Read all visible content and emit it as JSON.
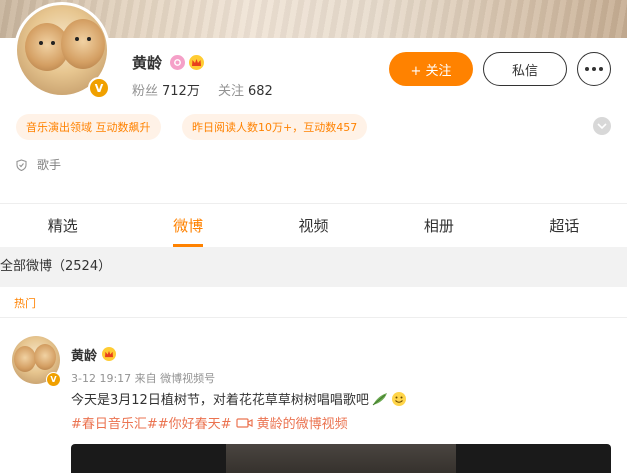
{
  "profile": {
    "name": "黄龄",
    "fans_label": "粉丝",
    "fans_count": "712万",
    "following_label": "关注",
    "following_count": "682",
    "verified_mark": "V",
    "follow_button": "+ 关注",
    "message_button": "私信",
    "tags": [
      "音乐演出领域 互动数飙升",
      "昨日阅读人数10万+，互动数457"
    ],
    "occupation": "歌手"
  },
  "tabs": [
    {
      "label": "精选",
      "active": false
    },
    {
      "label": "微博",
      "active": true
    },
    {
      "label": "视频",
      "active": false
    },
    {
      "label": "相册",
      "active": false
    },
    {
      "label": "超话",
      "active": false
    }
  ],
  "feed": {
    "all_label": "全部微博（2524）",
    "hot_label": "热门",
    "post": {
      "author": "黄龄",
      "time": "3-12 19:17",
      "source": "来自 微博视频号",
      "text": "今天是3月12日植树节，对着花花草草树树唱唱歌吧",
      "hashtags": "#春日音乐汇##你好春天#",
      "video_link": "黄龄的微博视频"
    }
  },
  "colors": {
    "accent": "#ff8200",
    "tag_bg": "#fff2e7",
    "link": "#eb7350",
    "verified": "#f0a000"
  },
  "icons": [
    "crown-icon",
    "badge-icon",
    "shield-icon",
    "chevron-down-icon",
    "more-icon",
    "video-link-icon",
    "leaf-emoji-icon",
    "smile-emoji-icon"
  ]
}
